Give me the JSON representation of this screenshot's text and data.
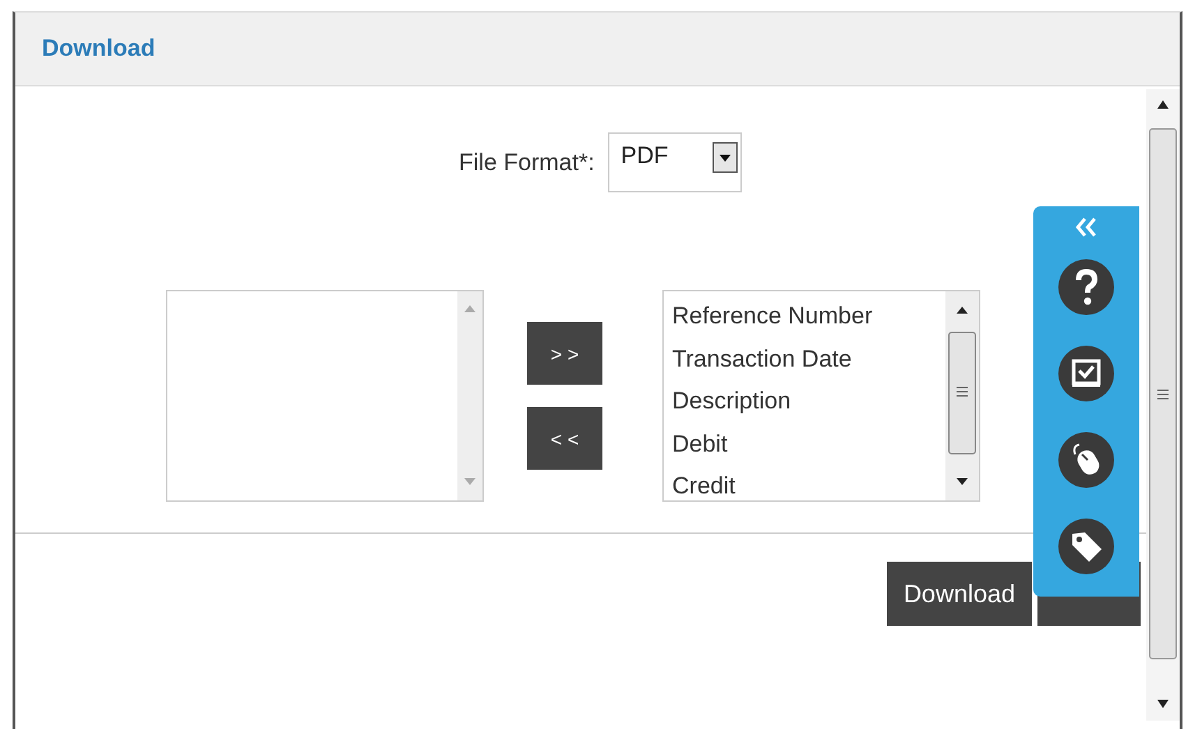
{
  "dialog": {
    "title": "Download"
  },
  "file_format": {
    "label": "File Format*:",
    "value": "PDF"
  },
  "selected_columns": {
    "items": [
      "Reference Number",
      "Transaction Date",
      "Description",
      "Debit",
      "Credit"
    ]
  },
  "move_buttons": [
    {
      "label": "> >"
    },
    {
      "label": "< <"
    }
  ],
  "buttons": [
    {
      "label": "Download"
    }
  ]
}
